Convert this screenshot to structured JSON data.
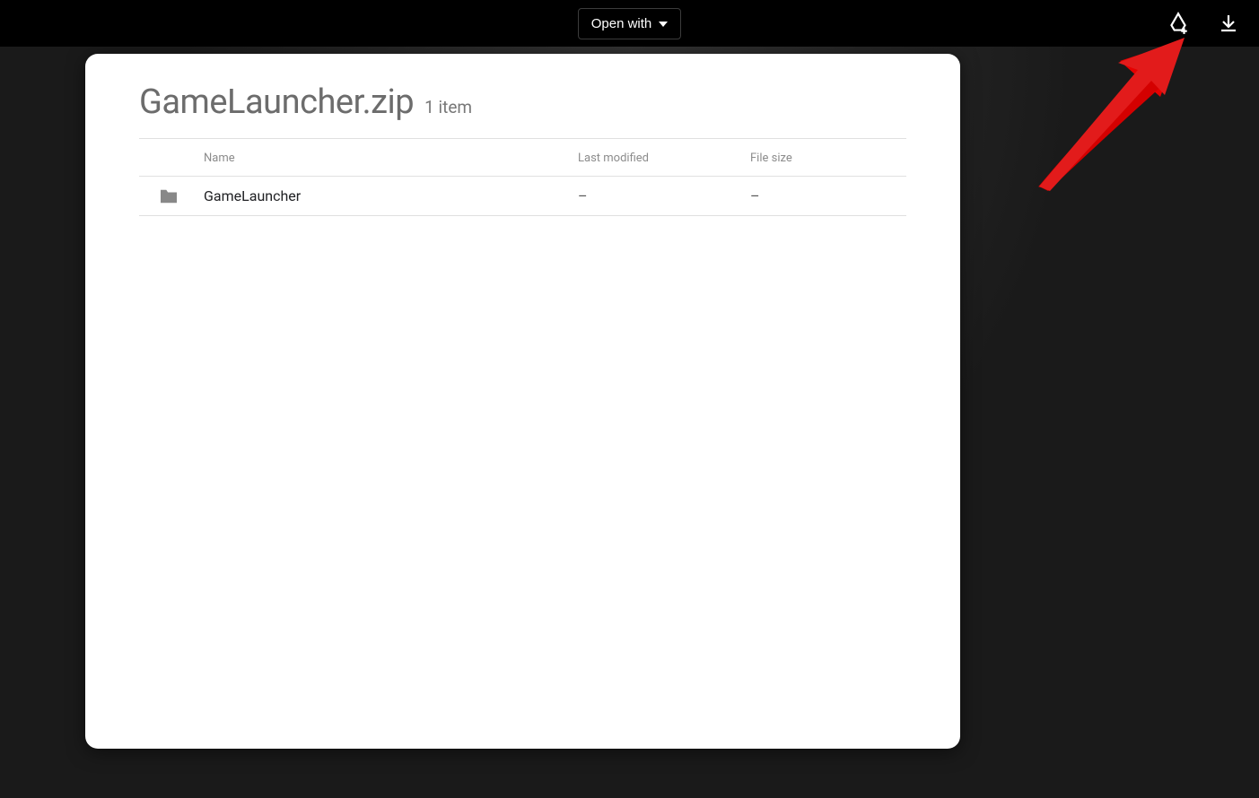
{
  "toolbar": {
    "open_with_label": "Open with"
  },
  "archive": {
    "filename": "GameLauncher.zip",
    "item_count_label": "1 item"
  },
  "table": {
    "headers": {
      "name": "Name",
      "last_modified": "Last modified",
      "file_size": "File size"
    },
    "rows": [
      {
        "name": "GameLauncher",
        "last_modified": "–",
        "file_size": "–"
      }
    ]
  }
}
